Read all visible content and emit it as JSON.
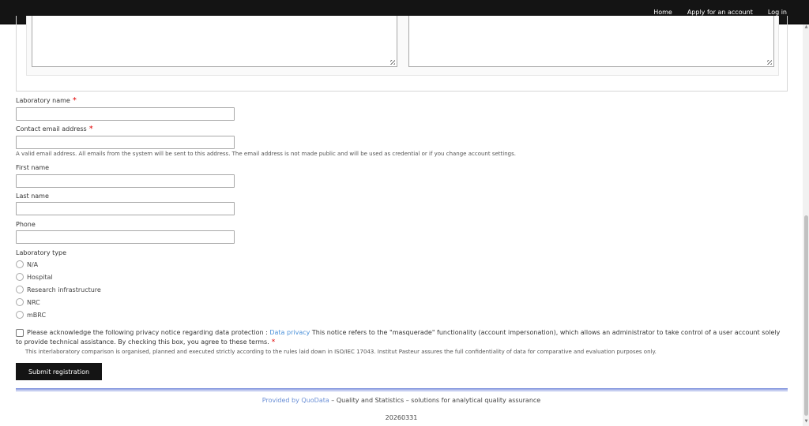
{
  "nav": {
    "home": "Home",
    "apply": "Apply for an account",
    "login": "Log in"
  },
  "form": {
    "lab_name_label": "Laboratory name",
    "email_label": "Contact email address",
    "email_help": "A valid email address. All emails from the system will be sent to this address. The email address is not made public and will be used as credential or if you change account settings.",
    "first_name_label": "First name",
    "last_name_label": "Last name",
    "phone_label": "Phone",
    "lab_type_label": "Laboratory type",
    "lab_type_options": [
      "N/A",
      "Hospital",
      "Research infrastructure",
      "NRC",
      "mBRC"
    ],
    "required_mark": "*",
    "privacy_text_before": "Please acknowledge the following privacy notice regarding data protection : ",
    "privacy_link": "Data privacy",
    "privacy_text_after": " This notice refers to the \"masquerade\" functionality (account impersonation), which allows an administrator to take control of a user account solely to provide technical assistance. By checking this box, you agree to these terms.",
    "privacy_note": "This interlaboratory comparison is organised, planned and executed strictly according to the rules laid down in ISO/IEC 17043. Institut Pasteur assures the full confidentiality of data for comparative and evaluation purposes only.",
    "submit_label": "Submit registration"
  },
  "footer": {
    "provided_by": "Provided by QuoData",
    "tagline": " – Quality and Statistics – solutions for analytical quality assurance",
    "version": "20260331"
  },
  "colors": {
    "nav_bg": "#141414",
    "required": "#e00000",
    "link": "#4a90d9",
    "footer_rule": "#8a9be0"
  }
}
